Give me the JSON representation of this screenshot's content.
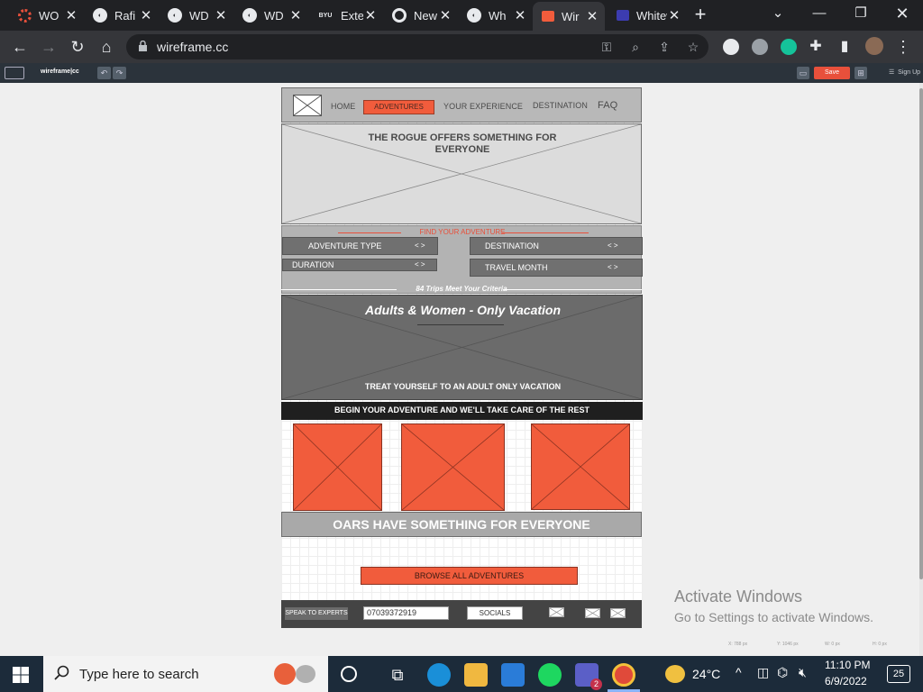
{
  "browser": {
    "tabs": [
      {
        "title": "WO",
        "icon": "opera-ring-icon",
        "color": "#e8503b"
      },
      {
        "title": "Rafi",
        "icon": "globe-icon",
        "color": "#e8eaed"
      },
      {
        "title": "WD",
        "icon": "globe-icon",
        "color": "#e8eaed"
      },
      {
        "title": "WD",
        "icon": "globe-icon",
        "color": "#e8eaed"
      },
      {
        "title": "Exte",
        "icon": "byu-icon",
        "color": "#e8eaed",
        "badge": "BYU"
      },
      {
        "title": "New",
        "icon": "chrome-icon",
        "color": "#e8eaed"
      },
      {
        "title": "Wh",
        "icon": "globe-icon",
        "color": "#e8eaed"
      },
      {
        "title": "Wir",
        "icon": "wireframe-icon",
        "color": "#f15c3c",
        "active": true
      },
      {
        "title": "Whitew",
        "icon": "whitewater-icon",
        "color": "#3c3cb0"
      }
    ],
    "url": "wireframe.cc"
  },
  "app": {
    "logo": "wireframe|cc",
    "save_label": "Save",
    "signup_label": "Sign Up"
  },
  "wireframe": {
    "nav": {
      "home": "HOME",
      "adventures": "ADVENTURES",
      "experience": "YOUR EXPERIENCE",
      "destination": "DESTINATION",
      "faq": "FAQ"
    },
    "hero_title": "THE ROGUE OFFERS SOMETHING FOR EVERYONE",
    "finder": {
      "title": "FIND YOUR ADVENTURE",
      "adventure_type": "ADVENTURE TYPE",
      "duration": "DURATION",
      "destination": "DESTINATION",
      "travel_month": "TRAVEL MONTH",
      "arrows": "< >",
      "trips": "84 Trips Meet Your Criteria"
    },
    "banner": {
      "title": "Adults & Women - Only Vacation",
      "subtitle": "TREAT YOURSELF TO AN ADULT ONLY VACATION"
    },
    "strip": "BEGIN YOUR ADVENTURE AND WE'LL TAKE CARE OF THE REST",
    "oars": "OARS HAVE SOMETHING FOR EVERYONE",
    "browse": "BROWSE ALL ADVENTURES",
    "footer": {
      "speak": "SPEAK TO EXPERTS",
      "phone": "07039372919",
      "socials": "SOCIALS"
    }
  },
  "watermark": {
    "line1": "Activate Windows",
    "line2": "Go to Settings to activate Windows."
  },
  "coords": {
    "x": "X: 788 px",
    "y": "Y: 1046 px",
    "w": "W: 0 px",
    "h": "H: 0 px"
  },
  "taskbar": {
    "search_placeholder": "Type here to search",
    "temperature": "24°C",
    "time": "11:10 PM",
    "date": "6/9/2022",
    "notification_count": "25",
    "teams_badge": "2"
  }
}
